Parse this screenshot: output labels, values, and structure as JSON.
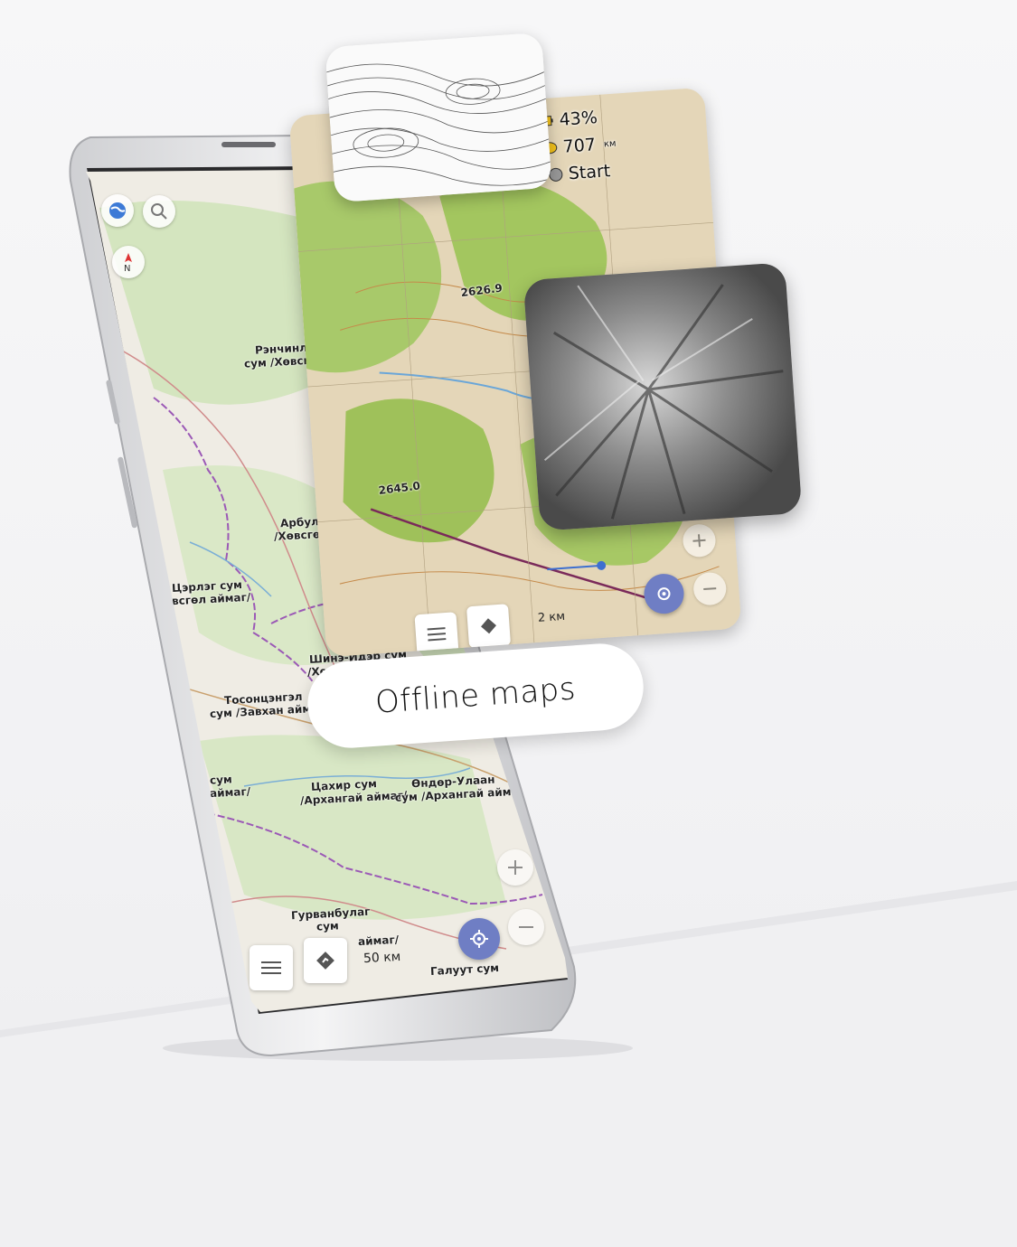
{
  "phone_map": {
    "labels": [
      {
        "key": "l1",
        "text": "Рэнчинлхүмбэ"
      },
      {
        "key": "l2",
        "text": "сум /Хөвсгөл аймаг/"
      },
      {
        "key": "l3",
        "text": "Арбулаг сум"
      },
      {
        "key": "l4",
        "text": "/Хөвсгөл аймаг/"
      },
      {
        "key": "l5",
        "text": "Цэрлэг сум"
      },
      {
        "key": "l6",
        "text": "всгөл аймаг/"
      },
      {
        "key": "l7",
        "text": "Шинэ-Идэр сум"
      },
      {
        "key": "l8",
        "text": "/Хөвсгөл аймаг/"
      },
      {
        "key": "l9",
        "text": "Тосонцэнгэл"
      },
      {
        "key": "l10",
        "text": "сум /Завхан айма"
      },
      {
        "key": "l11",
        "text": "сум"
      },
      {
        "key": "l12",
        "text": "аймаг/"
      },
      {
        "key": "l13",
        "text": "Цахир сум"
      },
      {
        "key": "l14",
        "text": "/Архангай аймаг/"
      },
      {
        "key": "l15",
        "text": "Өндөр-Улаан"
      },
      {
        "key": "l16",
        "text": "сум /Архангай аймаг/"
      },
      {
        "key": "l17",
        "text": "Гурванбулаг"
      },
      {
        "key": "l18",
        "text": "сум"
      },
      {
        "key": "l19",
        "text": "аймаг/"
      },
      {
        "key": "l20",
        "text": "Галуут сум"
      }
    ],
    "scale": "50 км",
    "icons": {
      "globe": "globe-icon",
      "search": "search-icon",
      "compass": "compass-icon",
      "menu": "menu-icon",
      "route": "route-icon",
      "locate": "locate-icon",
      "zoom_in": "zoom-in-icon",
      "zoom_out": "zoom-out-icon"
    }
  },
  "topo_card": {
    "battery": "43%",
    "distance": "707",
    "distance_unit": "км",
    "start": "Start",
    "elev1": "2626.9",
    "elev2": "2645.0",
    "scale": "2 км",
    "colors": {
      "accent": "#6f7ec4",
      "forest": "#9fc15a",
      "terrain": "#d9c3a0"
    }
  },
  "pill": {
    "label": "Offline maps"
  }
}
